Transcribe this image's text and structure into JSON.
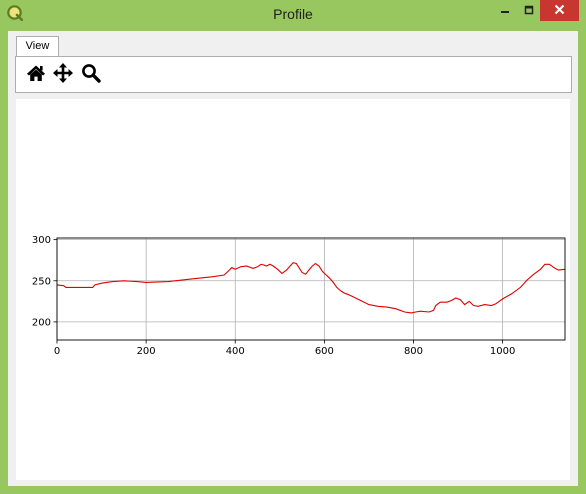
{
  "window": {
    "title": "Profile",
    "icon": "qgis-logo-icon",
    "controls": [
      "minimize-icon",
      "maximize-icon",
      "close-icon"
    ],
    "frame_color": "#97c75e",
    "close_color": "#c7372f"
  },
  "tabs": [
    {
      "label": "View",
      "selected": true
    }
  ],
  "toolbar": {
    "tools": [
      {
        "name": "home",
        "icon": "home-icon"
      },
      {
        "name": "pan",
        "icon": "move-arrows-icon"
      },
      {
        "name": "zoom",
        "icon": "magnifier-icon"
      }
    ]
  },
  "chart_data": {
    "type": "line",
    "title": "",
    "xlabel": "",
    "ylabel": "",
    "xlim": [
      0,
      1140
    ],
    "ylim": [
      178,
      302
    ],
    "grid": true,
    "xticks": [
      0,
      200,
      400,
      600,
      800,
      1000
    ],
    "yticks": [
      200,
      250,
      300
    ],
    "xtick_labels": [
      "0",
      "200",
      "400",
      "600",
      "800",
      "1000"
    ],
    "ytick_labels": [
      "200",
      "250",
      "300"
    ],
    "series": [
      {
        "color": "#e00000",
        "x": [
          0,
          15,
          20,
          80,
          85,
          100,
          125,
          150,
          180,
          200,
          250,
          300,
          350,
          375,
          385,
          392,
          400,
          412,
          425,
          440,
          450,
          458,
          465,
          470,
          478,
          485,
          495,
          505,
          515,
          523,
          530,
          537,
          543,
          550,
          558,
          565,
          573,
          580,
          588,
          596,
          604,
          612,
          620,
          628,
          636,
          645,
          655,
          670,
          685,
          700,
          720,
          740,
          760,
          780,
          795,
          805,
          815,
          835,
          845,
          850,
          860,
          875,
          885,
          895,
          905,
          915,
          925,
          935,
          945,
          960,
          975,
          985,
          1000,
          1020,
          1040,
          1055,
          1070,
          1085,
          1095,
          1105,
          1115,
          1125,
          1140
        ],
        "y": [
          245,
          244,
          242,
          242,
          245,
          247,
          249,
          250,
          249,
          248,
          249,
          252,
          255,
          257,
          262,
          266,
          264,
          267,
          268,
          265,
          267,
          270,
          269,
          268,
          270,
          268,
          264,
          259,
          263,
          268,
          272,
          271,
          266,
          260,
          258,
          263,
          268,
          271,
          268,
          261,
          257,
          253,
          248,
          242,
          238,
          235,
          233,
          229,
          225,
          221,
          219,
          218,
          216,
          212,
          211,
          212,
          213,
          212,
          214,
          220,
          224,
          224,
          226,
          229,
          227,
          221,
          225,
          220,
          219,
          221,
          220,
          222,
          228,
          234,
          242,
          251,
          258,
          264,
          270,
          270,
          266,
          263,
          264
        ]
      }
    ]
  }
}
